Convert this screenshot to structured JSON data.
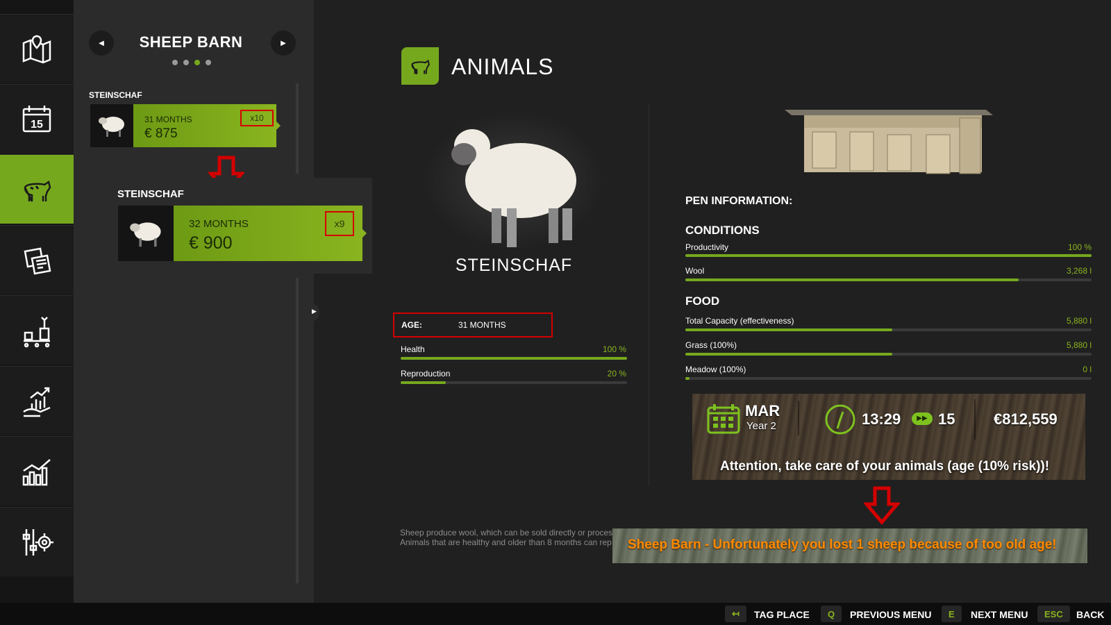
{
  "nav": {
    "items": [
      "map-icon",
      "calendar-icon",
      "animals-icon",
      "contracts-icon",
      "production-icon",
      "finance-icon",
      "statistics-icon",
      "settings-icon"
    ],
    "calendar_day": "15",
    "active_index": 2
  },
  "barn": {
    "title": "SHEEP BARN",
    "page_count": 4,
    "active_page": 2
  },
  "list": {
    "group1": {
      "breed": "STEINSCHAF",
      "age": "31 MONTHS",
      "price": "€ 875",
      "count": "x10"
    },
    "group2": {
      "breed": "STEINSCHAF",
      "age": "32 MONTHS",
      "price": "€ 900",
      "count": "x9"
    }
  },
  "animal": {
    "header": "ANIMALS",
    "name": "STEINSCHAF",
    "age_label": "AGE:",
    "age_value": "31 MONTHS",
    "stats": [
      {
        "label": "Health",
        "value": "100 %",
        "fraction": 1.0
      },
      {
        "label": "Reproduction",
        "value": "20 %",
        "fraction": 0.2
      }
    ],
    "description": [
      "Sheep produce wool, which can be sold directly or process",
      "Animals that are healthy and older than 8 months can rep"
    ]
  },
  "pen": {
    "title": "PEN INFORMATION:",
    "conditions_title": "CONDITIONS",
    "conditions": [
      {
        "label": "Productivity",
        "value": "100 %",
        "fraction": 1.0
      },
      {
        "label": "Wool",
        "value": "3,268 l",
        "fraction": 0.82
      }
    ],
    "food_title": "FOOD",
    "food": [
      {
        "label": "Total Capacity (effectiveness)",
        "value": "5,880 l",
        "fraction": 0.51
      },
      {
        "label": "Grass (100%)",
        "value": "5,880 l",
        "fraction": 0.51
      },
      {
        "label": "Meadow (100%)",
        "value": "0 l",
        "fraction": 0.01
      }
    ]
  },
  "hud": {
    "month": "MAR",
    "year": "Year 2",
    "time": "13:29",
    "speed": "15",
    "money": "€812,559",
    "warning": "Attention, take care of your animals (age (10% risk))!"
  },
  "notification": "Sheep Barn - Unfortunately you lost 1 sheep because of too old age!",
  "bottom": [
    {
      "key": "↤",
      "label": "TAG PLACE"
    },
    {
      "key": "Q",
      "label": "PREVIOUS MENU"
    },
    {
      "key": "E",
      "label": "NEXT MENU"
    },
    {
      "key": "ESC",
      "label": "BACK"
    }
  ],
  "colors": {
    "accent": "#76a81e",
    "annotation": "#d40000",
    "notice": "#ff8a00"
  }
}
